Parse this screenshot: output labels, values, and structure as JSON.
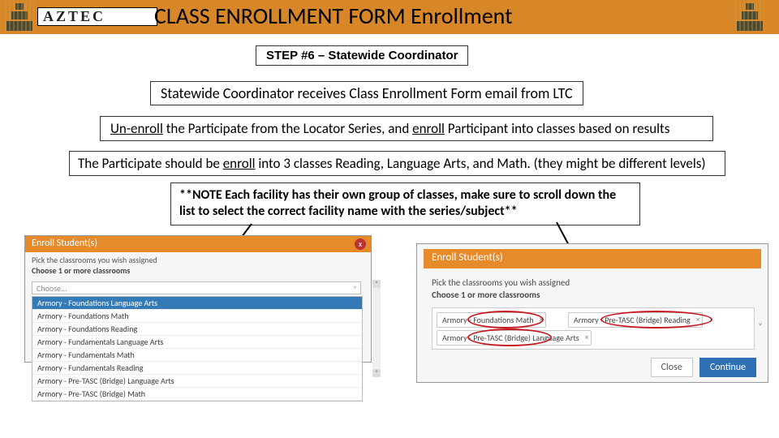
{
  "brand": {
    "name": "AZTEC"
  },
  "header": {
    "title": "CLASS ENROLLMENT FORM Enrollment"
  },
  "step": {
    "label": "STEP #6 – Statewide Coordinator"
  },
  "line2": {
    "text": "Statewide Coordinator receives Class Enrollment Form email from LTC"
  },
  "line3": {
    "pre": "Un-enroll",
    "mid1": " the Participate from the Locator Series, and ",
    "mid_u": "enroll",
    "post": " Participant into classes based on results"
  },
  "line4": {
    "pre": "The Participate should be ",
    "u": "enroll",
    "post": " into 3 classes Reading, Language Arts, and Math. (they might be different levels)"
  },
  "note": {
    "text": "**NOTE Each facility has their own group of classes, make sure to scroll down the list to select the correct facility name with the series/subject**"
  },
  "shotL": {
    "title": "Enroll Student(s)",
    "close": "x",
    "instr1": "Pick the classrooms you wish assigned",
    "instr2": "Choose 1 or more classrooms",
    "choose_placeholder": "Choose...",
    "options": [
      "Armory - Foundations Language Arts",
      "Armory - Foundations Math",
      "Armory - Foundations Reading",
      "Armory - Fundamentals Language Arts",
      "Armory - Fundamentals Math",
      "Armory - Fundamentals Reading",
      "Armory - Pre-TASC (Bridge) Language Arts",
      "Armory - Pre-TASC (Bridge) Math"
    ],
    "up": "˄",
    "dn": "˅"
  },
  "shotR": {
    "title": "Enroll Student(s)",
    "instr1": "Pick the classrooms you wish assigned",
    "instr2": "Choose 1 or more classrooms",
    "tag1_pre": "Armory - ",
    "tag1_mark": "Foundations Math",
    "tag2_pre": "Armory - ",
    "tag2_mark": "Pre-TASC (Bridge)",
    "tag2_post": " Reading",
    "tag3_pre": "Armory - ",
    "tag3_mark": "Pre-TASC (Bridge)",
    "tag3_post": " Language Arts",
    "x": "×",
    "chev": "˅",
    "close": "Close",
    "continue": "Continue"
  }
}
